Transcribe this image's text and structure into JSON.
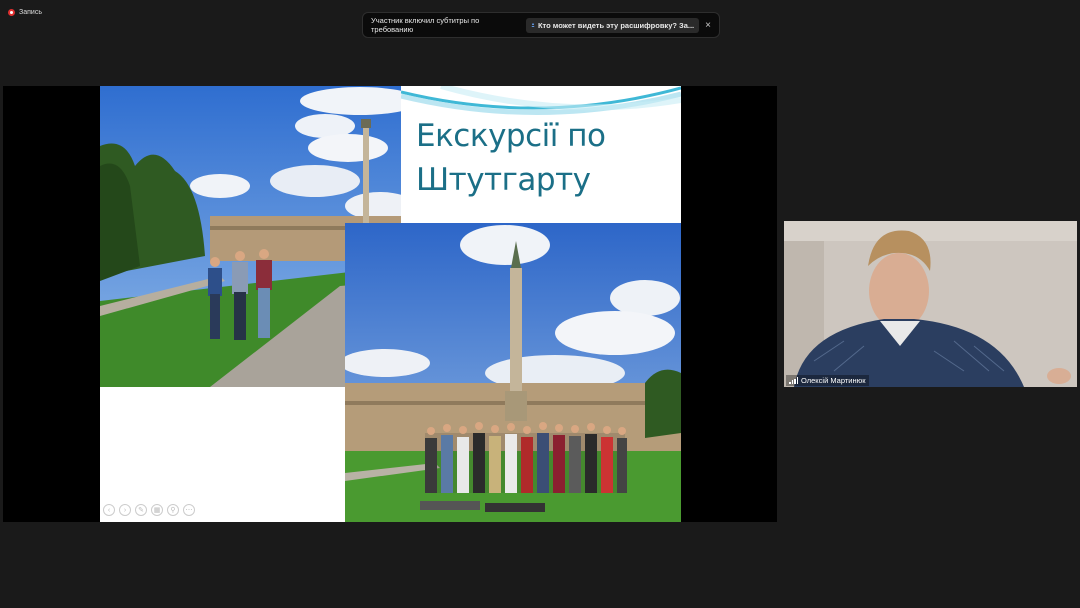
{
  "recording": {
    "label": "Запись"
  },
  "notification": {
    "message": "Участник включил субтитры по требованию",
    "link": "Кто может видеть эту расшифровку? За...",
    "close": "×"
  },
  "slide": {
    "title": "Екскурсії по\nШтутгарту"
  },
  "participant": {
    "name": "Олексій Мартинюк"
  },
  "colors": {
    "title": "#1b6f87",
    "background": "#1a1a1a"
  }
}
